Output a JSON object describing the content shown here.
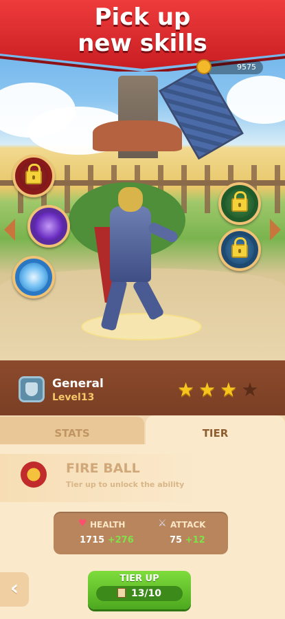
{
  "banner": {
    "line1": "Pick up",
    "line2": "new skills"
  },
  "currency": {
    "amount": "9575"
  },
  "skills_left": [
    {
      "name": "locked",
      "icon": "lock-icon"
    },
    {
      "name": "lightning",
      "icon": "lightning-icon"
    },
    {
      "name": "claw",
      "icon": "claw-icon"
    }
  ],
  "skills_right": [
    {
      "name": "locked",
      "icon": "lock-icon"
    },
    {
      "name": "locked",
      "icon": "lock-icon"
    }
  ],
  "hero": {
    "name": "General",
    "level": "Level13",
    "stars_filled": 3,
    "stars_total": 4
  },
  "tabs": {
    "stats": "STATS",
    "tier": "TIER"
  },
  "ability": {
    "name": "FIRE BALL",
    "description": "Tier up to unlock the ability"
  },
  "stats": {
    "health_label": "HEALTH",
    "health_value": "1715",
    "health_bonus": "+276",
    "attack_label": "ATTACK",
    "attack_value": "75",
    "attack_bonus": "+12"
  },
  "tier_button": {
    "label": "TIER UP",
    "count": "13/10"
  },
  "colors": {
    "banner": "#e0282d",
    "button": "#5fbf2a",
    "star": "#f8c51f",
    "bonus": "#7ee24a"
  }
}
